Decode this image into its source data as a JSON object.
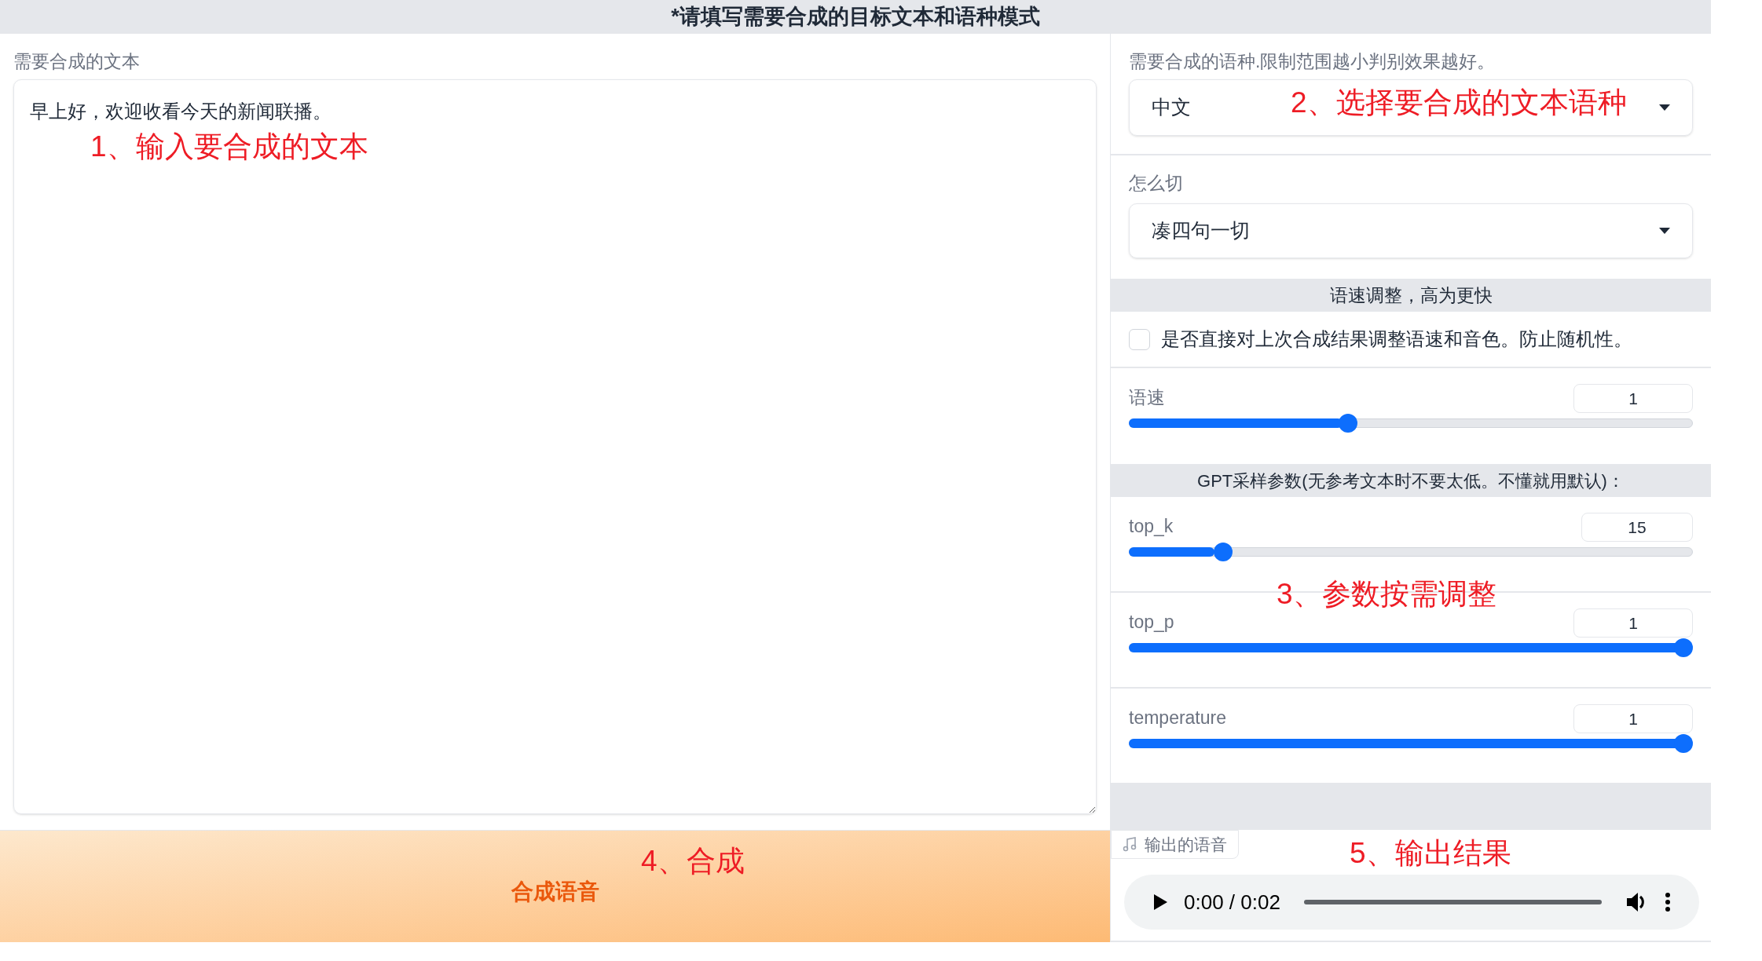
{
  "header": {
    "title": "*请填写需要合成的目标文本和语种模式"
  },
  "text_input": {
    "label": "需要合成的文本",
    "value": "早上好，欢迎收看今天的新闻联播。"
  },
  "synthesize_button": {
    "label": "合成语音"
  },
  "language": {
    "label": "需要合成的语种.限制范围越小判别效果越好。",
    "value": "中文"
  },
  "split": {
    "label": "怎么切",
    "value": "凑四句一切"
  },
  "speed_section": {
    "title": "语速调整，高为更快"
  },
  "reuse_checkbox": {
    "label": "是否直接对上次合成结果调整语速和音色。防止随机性。",
    "checked": false
  },
  "speed_slider": {
    "label": "语速",
    "value": "1",
    "level": 0.385
  },
  "gpt_section": {
    "title": "GPT采样参数(无参考文本时不要太低。不懂就用默认)："
  },
  "gpt_sliders": [
    {
      "label": "top_k",
      "value": "15",
      "level": 0.155
    },
    {
      "label": "top_p",
      "value": "1",
      "level": 1
    },
    {
      "label": "temperature",
      "value": "1",
      "level": 1
    }
  ],
  "output": {
    "label": "输出的语音",
    "time": "0:00 / 0:02",
    "level": 0
  },
  "annotations": [
    {
      "text": "1、输入要合成的文本"
    },
    {
      "text": "2、选择要合成的文本语种"
    },
    {
      "text": "3、参数按需调整"
    },
    {
      "text": "4、合成"
    },
    {
      "text": "5、输出结果"
    }
  ]
}
